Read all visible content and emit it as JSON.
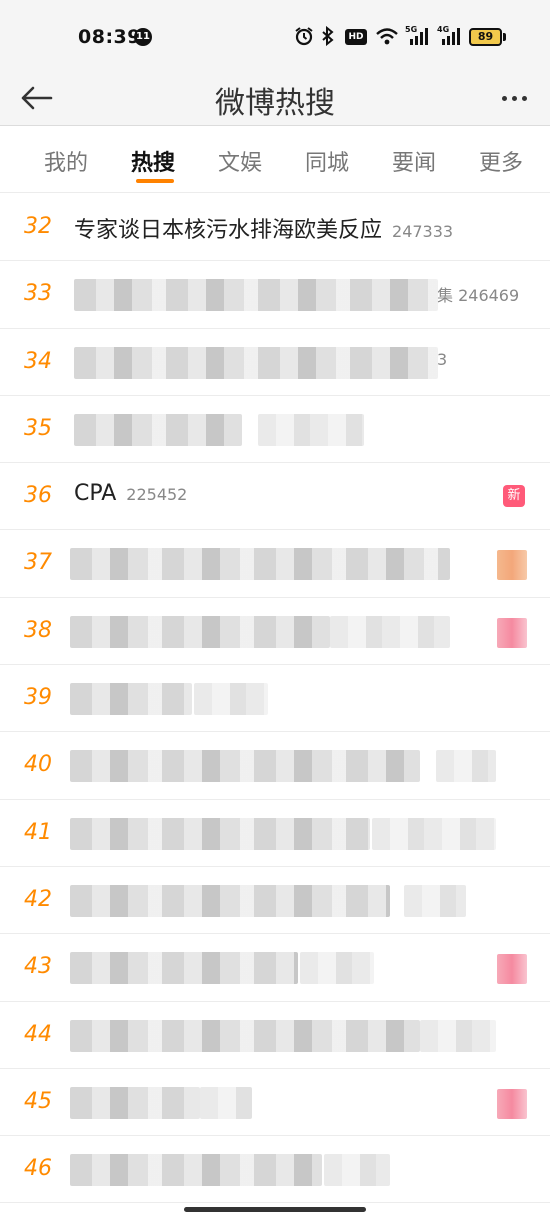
{
  "status_bar": {
    "time": "08:39",
    "notification_count": "11",
    "hd_label": "HD",
    "net1_label": "5G",
    "net2_label": "4G",
    "battery": "89"
  },
  "header": {
    "title": "微博热搜"
  },
  "tabs": [
    {
      "label": "我的"
    },
    {
      "label": "热搜"
    },
    {
      "label": "文娱"
    },
    {
      "label": "同城"
    },
    {
      "label": "要闻"
    },
    {
      "label": "更多"
    }
  ],
  "list": {
    "items": [
      {
        "rank": "32",
        "title": "专家谈日本核污水排海欧美反应",
        "heat": "247333"
      },
      {
        "rank": "33",
        "tail": "集 246469"
      },
      {
        "rank": "34",
        "tail": "3"
      },
      {
        "rank": "35"
      },
      {
        "rank": "36",
        "title": "CPA",
        "heat": "225452",
        "tag": "新"
      },
      {
        "rank": "37"
      },
      {
        "rank": "38"
      },
      {
        "rank": "39"
      },
      {
        "rank": "40"
      },
      {
        "rank": "41"
      },
      {
        "rank": "42"
      },
      {
        "rank": "43"
      },
      {
        "rank": "44"
      },
      {
        "rank": "45"
      },
      {
        "rank": "46"
      }
    ]
  },
  "colors": {
    "accent": "#ff8200",
    "rank": "#ff8a00",
    "new_tag": "#ff5a79"
  }
}
